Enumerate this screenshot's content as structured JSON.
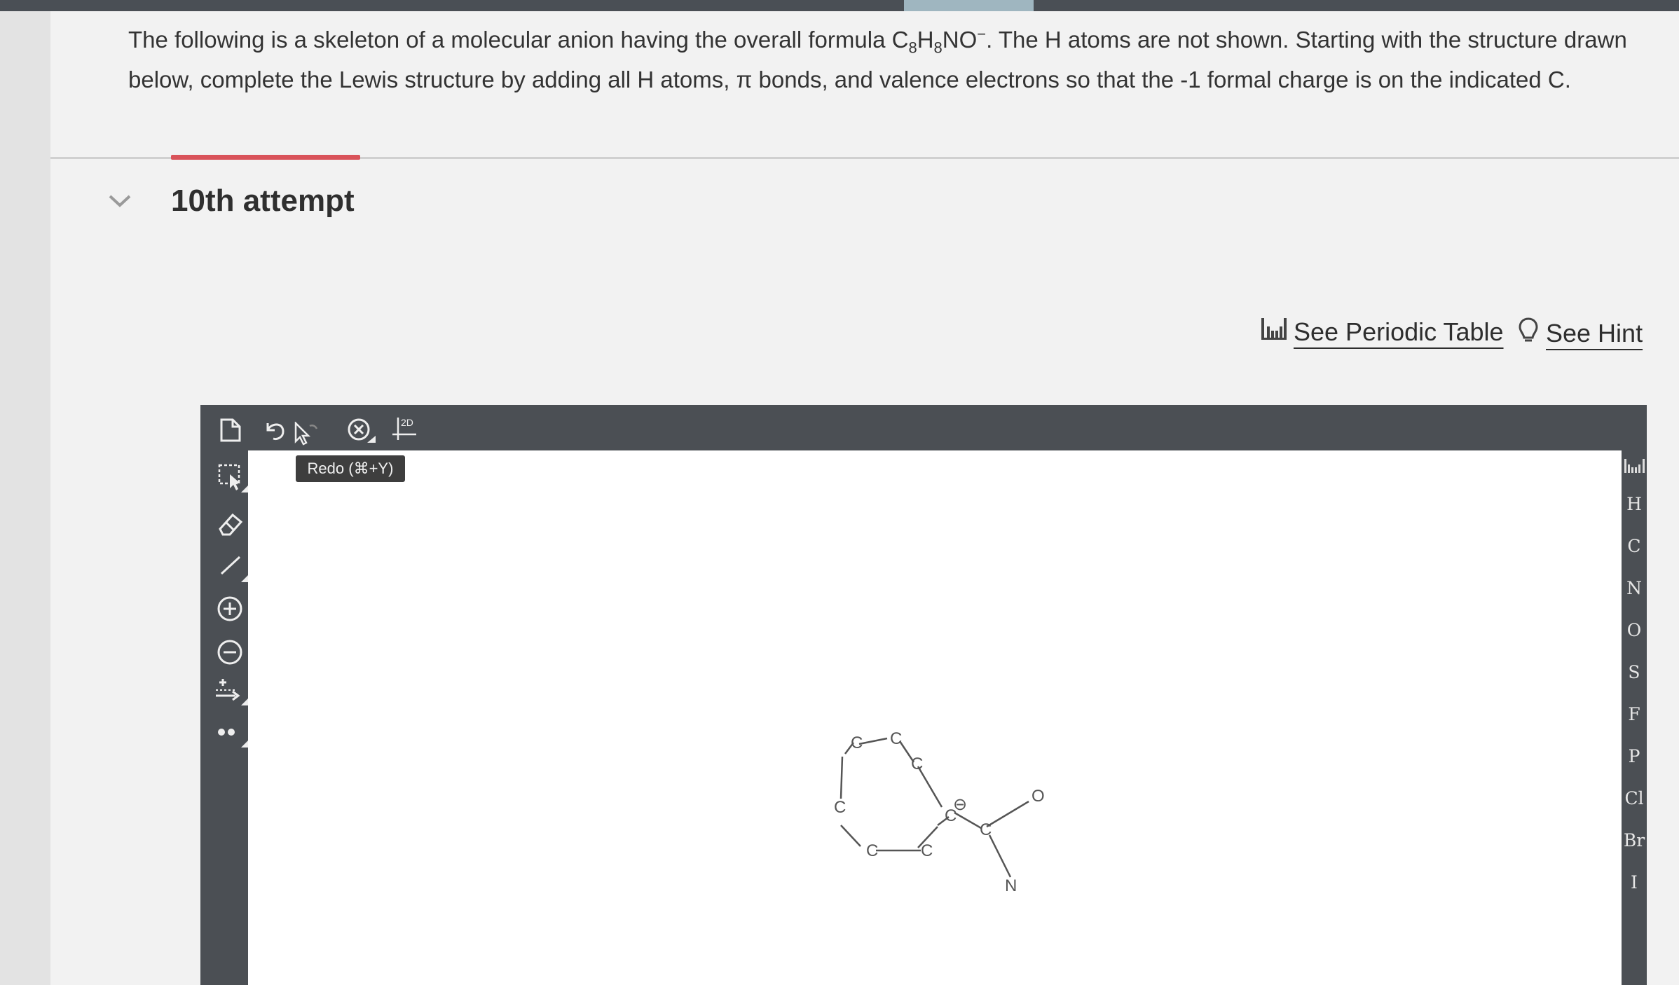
{
  "question": {
    "part1": "The following is a skeleton of a molecular anion having the overall formula C",
    "sub1": "8",
    "part2": "H",
    "sub2": "8",
    "part3": "NO",
    "sup1": "−",
    "part4": ". The H atoms are not shown. Starting with the structure drawn below, complete the Lewis structure by adding all H atoms, π bonds, and valence electrons so that the -1 formal charge is on the indicated C."
  },
  "attempt": {
    "label": "10th attempt"
  },
  "links": {
    "periodic_table": "See Periodic Table",
    "hint": "See Hint"
  },
  "editor": {
    "tooltip": "Redo (⌘+Y)",
    "mode_label": "2D",
    "elements": [
      "H",
      "C",
      "N",
      "O",
      "S",
      "F",
      "P",
      "Cl",
      "Br",
      "I"
    ]
  },
  "molecule": {
    "atoms": [
      "C",
      "C",
      "C",
      "C",
      "C",
      "C",
      "C",
      "C",
      "O",
      "N"
    ],
    "charge": "⊖"
  },
  "colors": {
    "accent": "#d9535a",
    "toolbar": "#4b4f54",
    "canvas": "#ffffff"
  },
  "icons": [
    "new-document-icon",
    "undo-icon",
    "redo-icon",
    "clear-icon",
    "clean-2d-icon",
    "select-icon",
    "eraser-icon",
    "bond-icon",
    "positive-charge-icon",
    "negative-charge-icon",
    "arrow-icon",
    "electrons-icon",
    "periodic-table-icon",
    "hint-icon",
    "chevron-down-icon"
  ]
}
